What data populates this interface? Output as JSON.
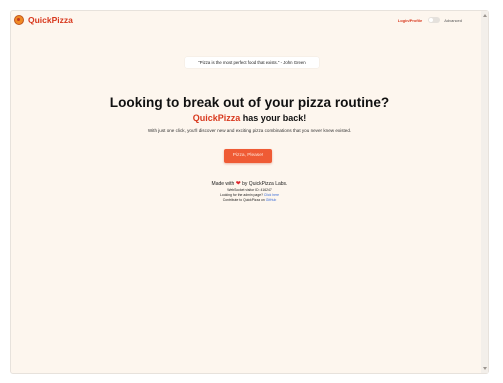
{
  "header": {
    "brand_name": "QuickPizza",
    "login_label": "Login/Profile",
    "advanced_label": "Advanced",
    "advanced_enabled": false
  },
  "quote": "\"Pizza is the most perfect food that exists.\" - John Green",
  "hero": {
    "title": "Looking to break out of your pizza routine?",
    "subtitle_brand": "QuickPizza",
    "subtitle_rest": " has your back!",
    "description": "With just one click, you'll discover new and exciting pizza combinations that you never knew existed."
  },
  "cta": {
    "label": "Pizza, Please!"
  },
  "footer": {
    "made_with_prefix": "Made with",
    "made_with_suffix": "by QuickPizza Labs.",
    "web_socket": "WebSocket visitor ID: 416247",
    "admin_prefix": "Looking for the admin page? ",
    "admin_link": "Click here",
    "contribute_prefix": "Contribute to QuickPizza on ",
    "contribute_link": "GitHub"
  },
  "colors": {
    "brand": "#d8381d",
    "button": "#ef5b35",
    "background": "#fdf6ee",
    "link": "#3a6bd6"
  },
  "icons": {
    "logo": "pizza-logo-icon",
    "heart": "heart-icon"
  }
}
